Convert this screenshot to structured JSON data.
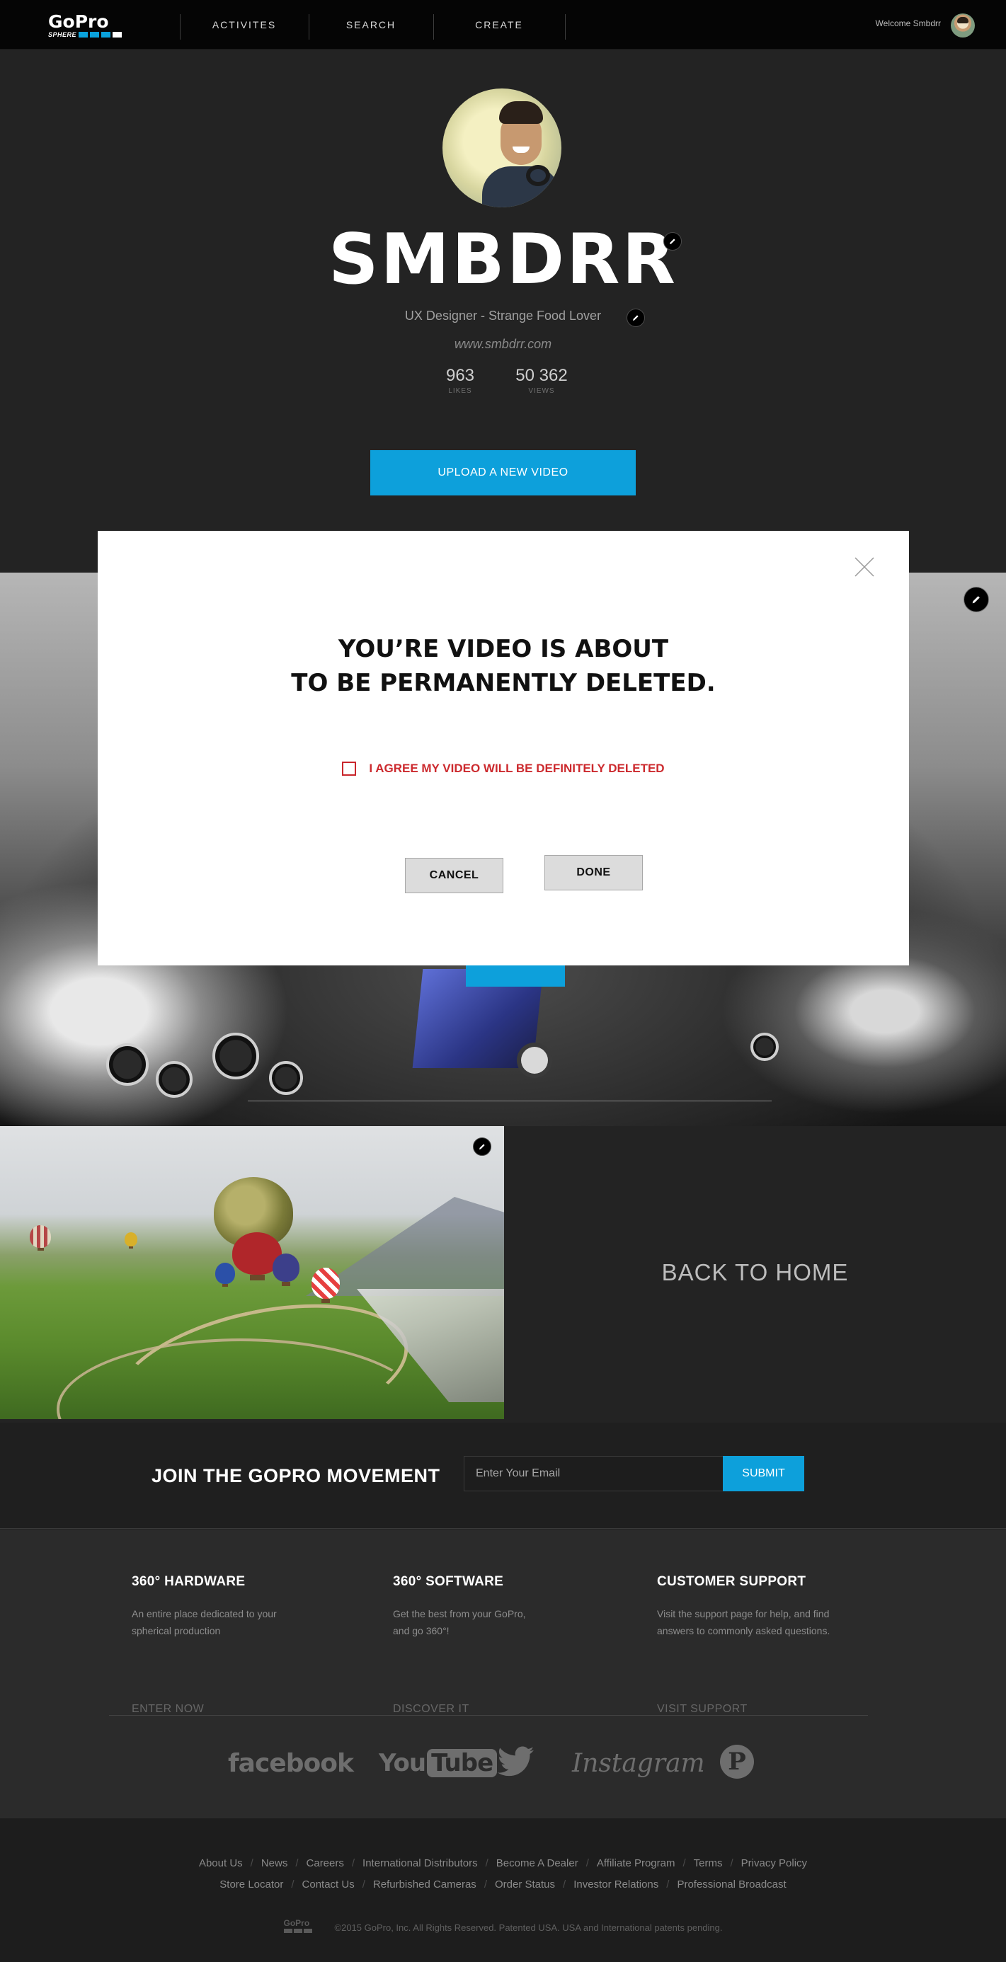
{
  "nav": {
    "brand": "GoPro",
    "brand_sub": "SPHERE",
    "links": [
      "ACTIVITES",
      "SEARCH",
      "CREATE"
    ],
    "welcome": "Welcome Smbdrr"
  },
  "profile": {
    "username": "SMBDRR",
    "bio": "UX Designer - Strange Food Lover",
    "website": "www.smbdrr.com",
    "stats": [
      {
        "value": "963",
        "label": "LIKES"
      },
      {
        "value": "50 362",
        "label": "VIEWS"
      }
    ],
    "upload_label": "UPLOAD A NEW VIDEO"
  },
  "modal": {
    "title_line1": "YOU’RE VIDEO IS ABOUT",
    "title_line2": "TO BE PERMANENTLY DELETED.",
    "agree_text": "I AGREE MY VIDEO WILL BE DEFINITELY DELETED",
    "agree_checked": false,
    "cancel_label": "CANCEL",
    "done_label": "DONE"
  },
  "back_home_label": "BACK TO HOME",
  "join": {
    "title": "JOIN THE GOPRO MOVEMENT",
    "placeholder": "Enter Your Email",
    "submit_label": "SUBMIT"
  },
  "footer_columns": [
    {
      "title": "360° HARDWARE",
      "line1": "An entire place dedicated to your",
      "line2": "spherical production",
      "cta": "ENTER NOW"
    },
    {
      "title": "360° SOFTWARE",
      "line1": "Get the best from your GoPro,",
      "line2": "and go 360°!",
      "cta": "DISCOVER IT"
    },
    {
      "title": "CUSTOMER SUPPORT",
      "line1": "Visit the support page for help, and find",
      "line2": "answers to commonly asked questions.",
      "cta": "VISIT SUPPORT"
    }
  ],
  "social": {
    "facebook": "facebook",
    "youtube_you": "You",
    "youtube_tube": "Tube",
    "instagram": "Instagram",
    "pinterest": "P"
  },
  "bottom": {
    "links_row1": [
      "About Us",
      "News",
      "Careers",
      "International Distributors",
      "Become A Dealer",
      "Affiliate Program",
      "Terms",
      "Privacy Policy"
    ],
    "links_row2": [
      "Store Locator",
      "Contact Us",
      "Refurbished Cameras",
      "Order Status",
      "Investor Relations",
      "Professional Broadcast"
    ],
    "mini_logo": "GoPro",
    "copyright": "©2015 GoPro, Inc. All Rights Reserved. Patented USA. USA and International patents pending."
  },
  "colors": {
    "accent": "#0da0db",
    "warning": "#cc2a2e",
    "background": "#232323"
  }
}
